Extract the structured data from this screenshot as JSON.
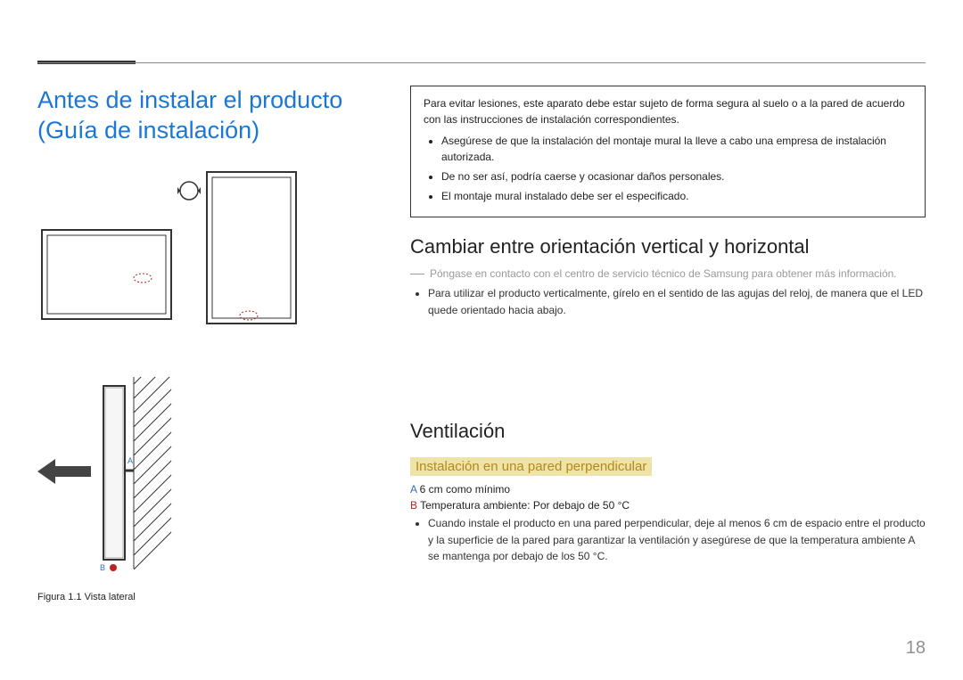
{
  "page_number": "18",
  "left": {
    "title": "Antes de instalar el producto (Guía de instalación)",
    "figure_caption": "Figura 1.1 Vista lateral",
    "labels": {
      "A": "A",
      "B": "B"
    }
  },
  "right": {
    "warning": {
      "intro": "Para evitar lesiones, este aparato debe estar sujeto de forma segura al suelo o a la pared de acuerdo con las instrucciones de instalación correspondientes.",
      "items": [
        "Asegúrese de que la instalación del montaje mural la lleve a cabo una empresa de instalación autorizada.",
        "De no ser así, podría caerse y ocasionar daños personales.",
        "El montaje mural instalado debe ser el especificado."
      ]
    },
    "orientation": {
      "heading": "Cambiar entre orientación vertical y horizontal",
      "note": "Póngase en contacto con el centro de servicio técnico de Samsung para obtener más información.",
      "items": [
        "Para utilizar el producto verticalmente, gírelo en el sentido de las agujas del reloj, de manera que el LED quede orientado hacia abajo."
      ]
    },
    "ventilation": {
      "heading": "Ventilación",
      "sub_heading": "Instalación en una pared perpendicular",
      "spec_a_label": "A",
      "spec_a_text": " 6 cm como mínimo",
      "spec_b_label": "B",
      "spec_b_text": " Temperatura ambiente: Por debajo de 50 °C",
      "items": [
        "Cuando instale el producto en una pared perpendicular, deje al menos 6 cm de espacio entre el producto y la superficie de la pared para garantizar la ventilación y asegúrese de que la temperatura ambiente A se mantenga por debajo de los 50 °C."
      ]
    }
  }
}
